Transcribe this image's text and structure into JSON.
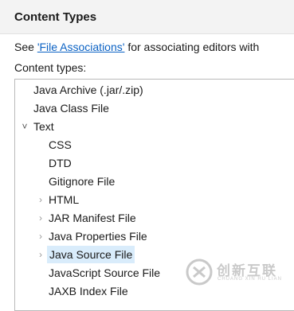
{
  "header": {
    "title": "Content Types"
  },
  "intro": {
    "prefix": "See ",
    "link_label": "'File Associations'",
    "suffix": " for associating editors with"
  },
  "tree_label": "Content types:",
  "tree": {
    "items": [
      {
        "label": "Java Archive (.jar/.zip)",
        "level": 0,
        "twisty": "none"
      },
      {
        "label": "Java Class File",
        "level": 0,
        "twisty": "none"
      },
      {
        "label": "Text",
        "level": 0,
        "twisty": "expanded"
      },
      {
        "label": "CSS",
        "level": 1,
        "twisty": "none"
      },
      {
        "label": "DTD",
        "level": 1,
        "twisty": "none"
      },
      {
        "label": "Gitignore File",
        "level": 1,
        "twisty": "none"
      },
      {
        "label": "HTML",
        "level": 1,
        "twisty": "collapsed"
      },
      {
        "label": "JAR Manifest File",
        "level": 1,
        "twisty": "collapsed"
      },
      {
        "label": "Java Properties File",
        "level": 1,
        "twisty": "collapsed"
      },
      {
        "label": "Java Source File",
        "level": 1,
        "twisty": "collapsed",
        "selected": true
      },
      {
        "label": "JavaScript Source File",
        "level": 1,
        "twisty": "none"
      },
      {
        "label": "JAXB Index File",
        "level": 1,
        "twisty": "none"
      }
    ]
  },
  "watermark": {
    "text": "创新互联",
    "subtext": "CHUANG XIN HU LIAN"
  },
  "colors": {
    "link": "#0b62c4",
    "selection": "#d9ecfb",
    "header_bg": "#f3f3f3"
  },
  "icons": {
    "expanded": "chevron-down-icon",
    "collapsed": "chevron-right-icon",
    "watermark_logo": "logo-icon"
  }
}
